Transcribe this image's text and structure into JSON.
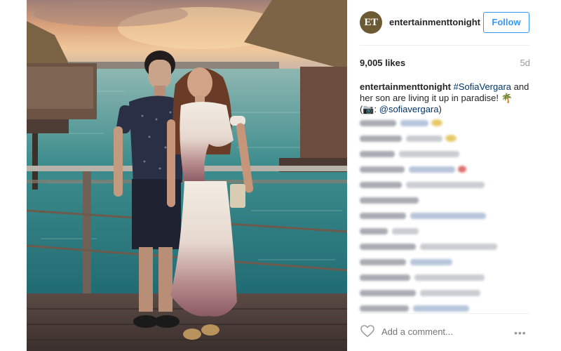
{
  "post": {
    "author": "entertainmenttonight",
    "avatar_text": "ET",
    "follow_label": "Follow",
    "likes": "9,005 likes",
    "age": "5d",
    "caption": {
      "user": "entertainmenttonight",
      "hashtag": "#SofiaVergara",
      "text1": " and her son are living it up in paradise! ",
      "palm": "🌴",
      "credit_open": "(📷: ",
      "mention": "@sofiavergara",
      "credit_close": ")"
    }
  },
  "comments": [
    {
      "user_w": 52,
      "text_w": 40,
      "emoji": true
    },
    {
      "user_w": 60,
      "text_w": 52,
      "emoji": true
    },
    {
      "user_w": 50,
      "text_w": 86
    },
    {
      "user_w": 64,
      "text_w": 66,
      "red": true
    },
    {
      "user_w": 60,
      "text_w": 112
    },
    {
      "user_w": 84,
      "text_w": 0
    },
    {
      "user_w": 66,
      "text_w": 108
    },
    {
      "user_w": 40,
      "text_w": 38
    },
    {
      "user_w": 80,
      "text_w": 110
    },
    {
      "user_w": 66,
      "text_w": 60
    },
    {
      "user_w": 72,
      "text_w": 100
    },
    {
      "user_w": 80,
      "text_w": 86
    },
    {
      "user_w": 70,
      "text_w": 80
    }
  ],
  "footer": {
    "comment_placeholder": "Add a comment...",
    "more_label": "•••"
  },
  "colors": {
    "accent": "#3897f0",
    "link": "#003569",
    "muted": "#999999"
  },
  "icons": {
    "like": "heart-icon",
    "more": "more-options-icon"
  }
}
